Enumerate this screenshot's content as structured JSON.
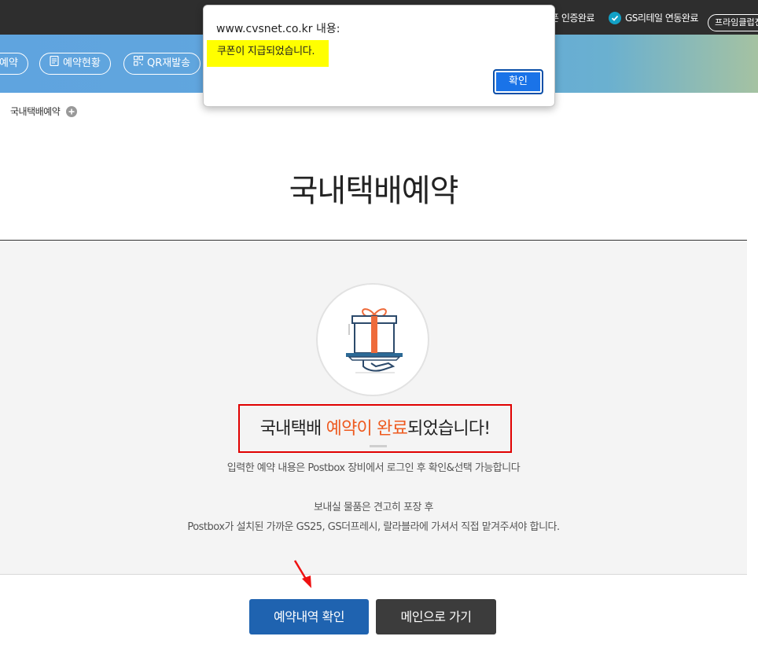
{
  "topbar": {
    "status1": "폰 인증완료",
    "status2": "GS리테일 연동완료",
    "prime_button": "프라임클럽전"
  },
  "nav": {
    "items": [
      {
        "label": "예약"
      },
      {
        "label": "예약현황"
      },
      {
        "label": "QR재발송"
      }
    ]
  },
  "breadcrumb": {
    "label": "국내택배예약"
  },
  "page": {
    "title": "국내택배예약"
  },
  "completion": {
    "prefix": "국내택배 ",
    "highlight": "예약이 완료",
    "suffix": "되었습니다!",
    "desc1": "입력한 예약 내용은 Postbox 장비에서 로그인 후 확인&선택 가능합니다",
    "desc2": "보내실 물품은 견고히 포장 후",
    "desc3": "Postbox가 설치된 가까운 GS25, GS더프레시, 랄라블라에 가셔서 직접 맡겨주셔야 합니다."
  },
  "buttons": {
    "check_reservation": "예약내역 확인",
    "go_main": "메인으로 가기"
  },
  "dialog": {
    "title": "www.cvsnet.co.kr 내용:",
    "message": "쿠폰이 지급되었습니다.",
    "ok_label": "확인"
  },
  "colors": {
    "highlight_orange": "#ee5a1f",
    "primary_blue": "#1f63b0",
    "dark_button": "#3c3c3c",
    "annotation_red": "#e00000",
    "marker_yellow": "#ffff00"
  }
}
